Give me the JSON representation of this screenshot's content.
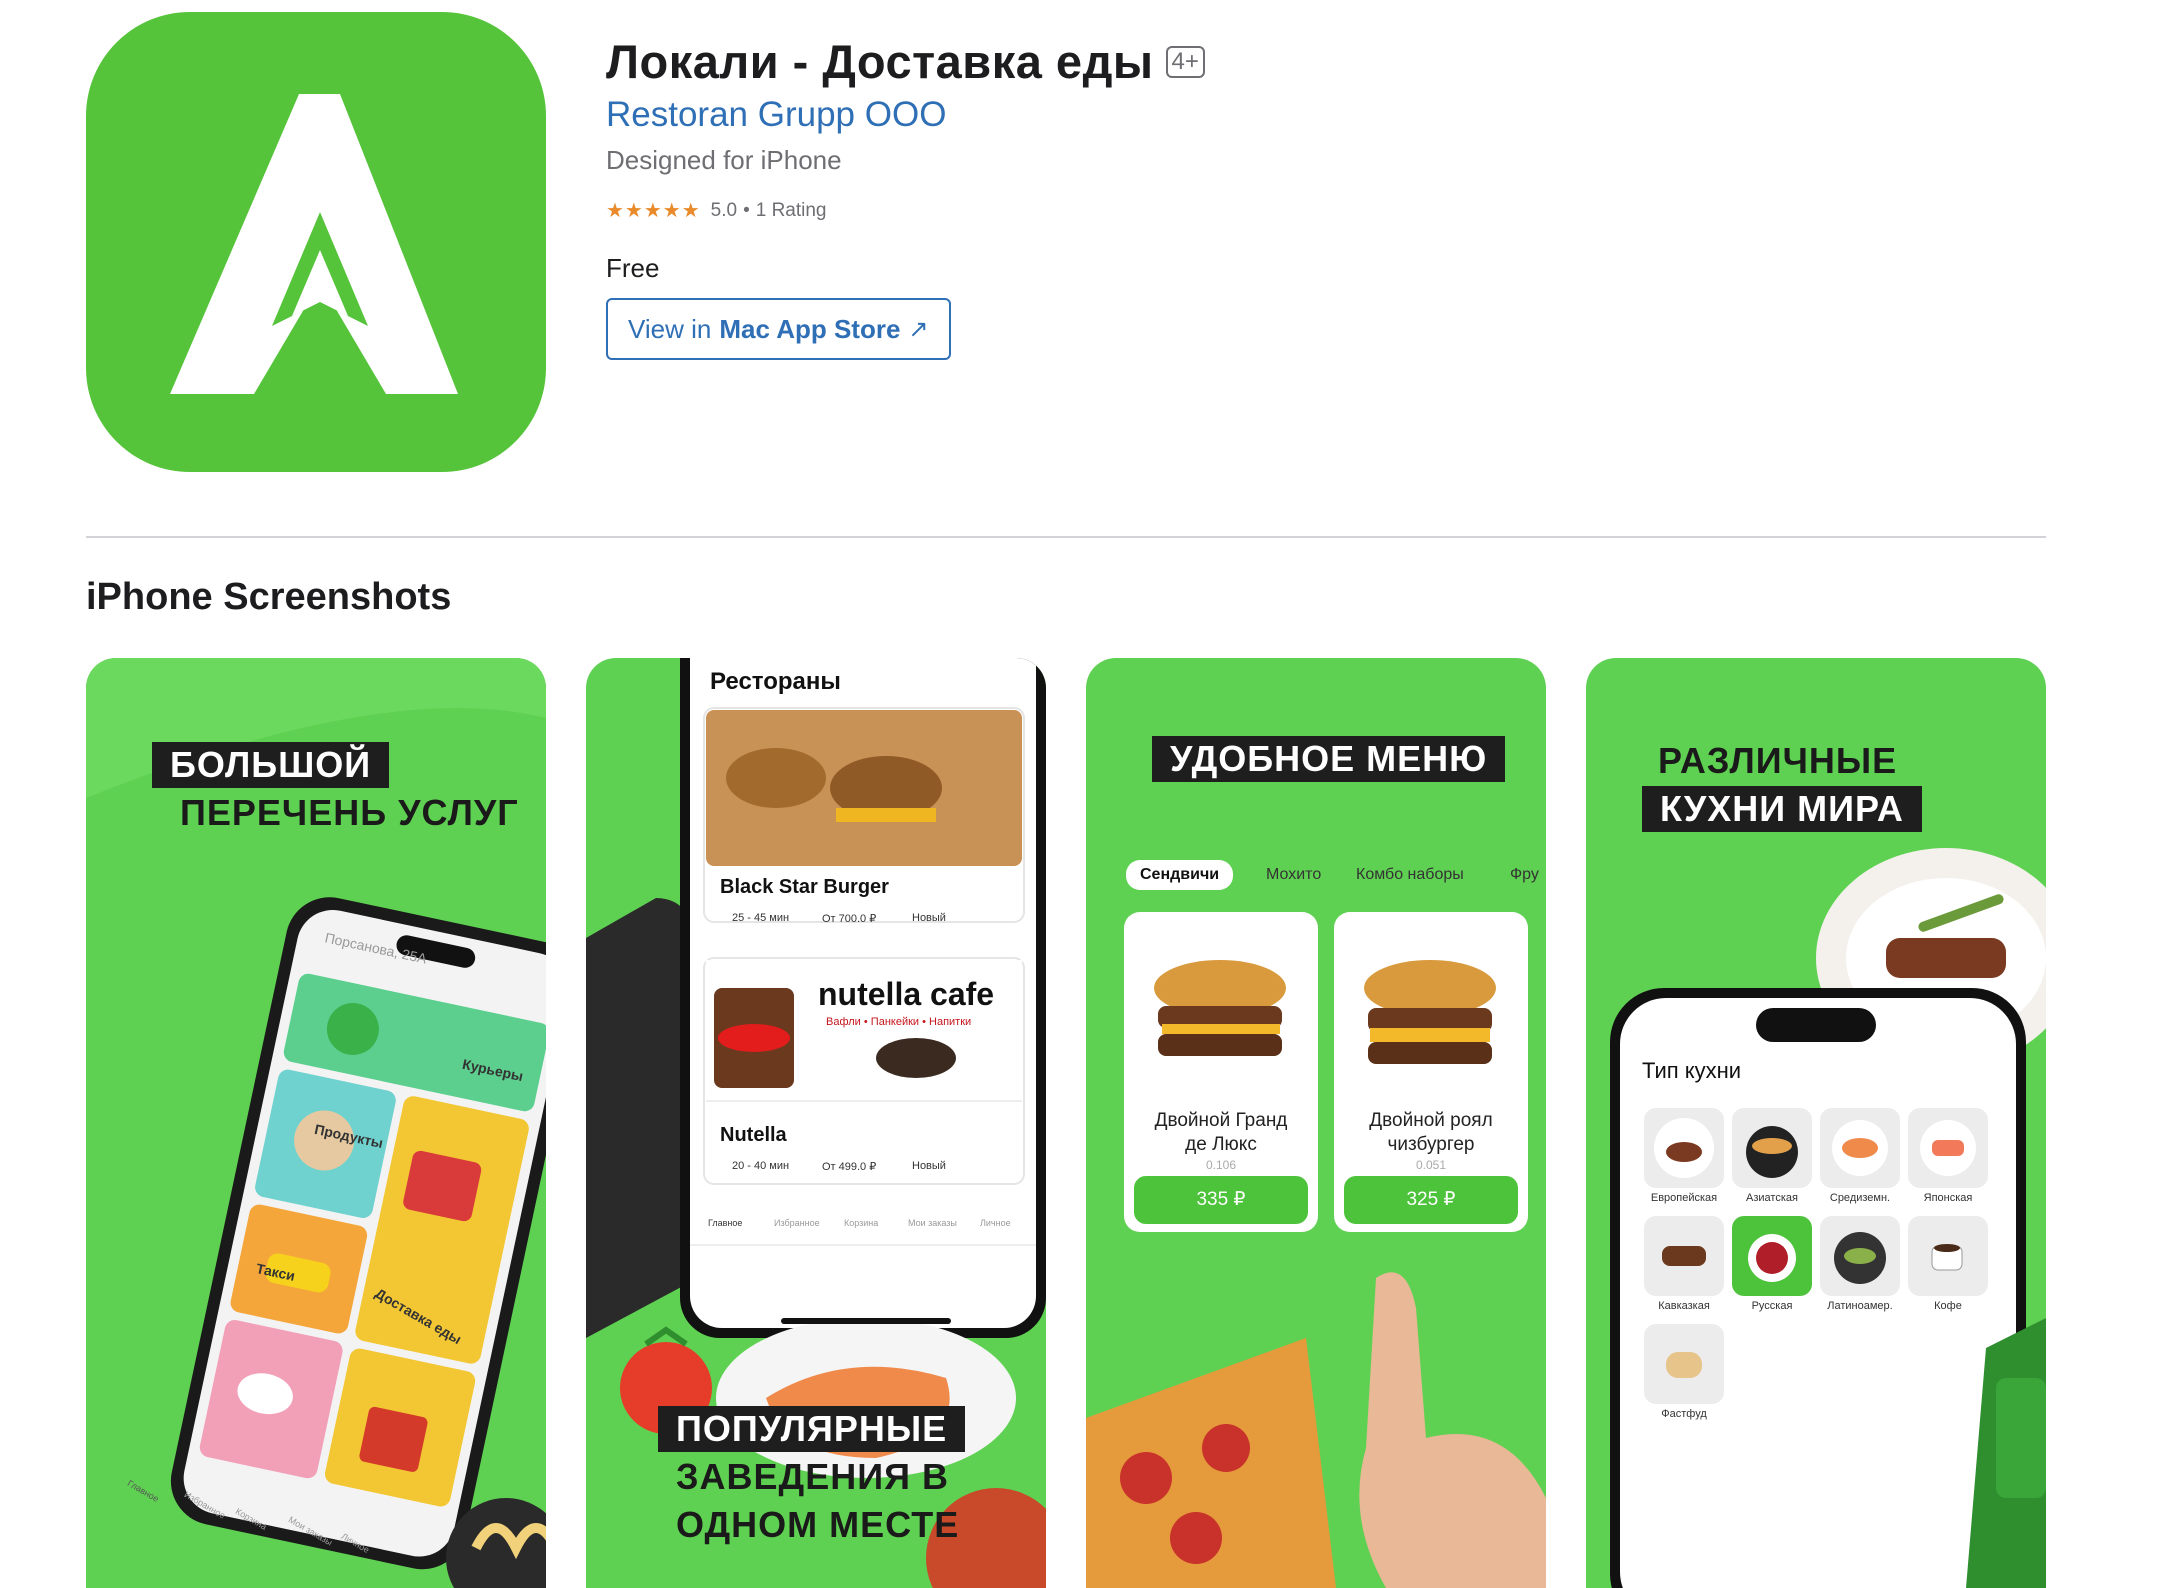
{
  "app": {
    "title": "Локали - Доставка еды",
    "age_rating": "4+",
    "developer": "Restoran Grupp OOO",
    "designed_for": "Designed for iPhone",
    "stars": "★★★★★",
    "rating_value": "5.0",
    "rating_separator": "•",
    "rating_count": "1 Rating",
    "price": "Free",
    "store_button": {
      "prefix": "View in",
      "name": "Mac App Store",
      "arrow": "↗"
    },
    "icon": "app-logo-icon",
    "brand_color": "#55c43a"
  },
  "screenshots_section": {
    "title": "iPhone Screenshots",
    "shot1": {
      "caption_line1": "БОЛЬШОЙ",
      "caption_line2": "ПЕРЕЧЕНЬ УСЛУГ",
      "address": "Порсанова, 25А",
      "tiles": [
        "Курьеры",
        "Продукты",
        "Такси",
        "Доставка еды"
      ],
      "nav": [
        "Главное",
        "Избранное",
        "Корзина",
        "Мои заказы",
        "Личное"
      ]
    },
    "shot2": {
      "screen_title": "Рестораны",
      "cards": [
        {
          "name": "Black Star Burger",
          "time": "25 - 45 мин",
          "price": "От 700.0 ₽",
          "badge": "Новый"
        },
        {
          "name": "Nutella",
          "time": "20 - 40 мин",
          "price": "От 499.0 ₽",
          "badge": "Новый"
        }
      ],
      "banner_logo": "nutella cafe",
      "banner_sub": "Вафли • Панкейки • Напитки",
      "nav": [
        "Главное",
        "Избранное",
        "Корзина",
        "Мои заказы",
        "Личное"
      ],
      "caption_line1": "ПОПУЛЯРНЫЕ",
      "caption_line2": "ЗАВЕДЕНИЯ В",
      "caption_line3": "ОДНОМ МЕСТЕ"
    },
    "shot3": {
      "caption": "УДОБНОЕ МЕНЮ",
      "tabs": [
        "Сендвичи",
        "Мохито",
        "Комбо наборы",
        "Фру"
      ],
      "items": [
        {
          "name_line1": "Двойной Гранд",
          "name_line2": "де Люкс",
          "weight": "0.106",
          "price": "335 ₽"
        },
        {
          "name_line1": "Двойной роял",
          "name_line2": "чизбургер",
          "weight": "0.051",
          "price": "325 ₽"
        }
      ]
    },
    "shot4": {
      "caption_line1": "РАЗЛИЧНЫЕ",
      "caption_line2": "КУХНИ МИРА",
      "screen_title": "Тип кухни",
      "cuisines": [
        "Европейская",
        "Азиатская",
        "Средиземн.",
        "Японская",
        "Кавказкая",
        "Русская",
        "Латиноамер.",
        "Кофе",
        "Фастфуд"
      ]
    }
  }
}
